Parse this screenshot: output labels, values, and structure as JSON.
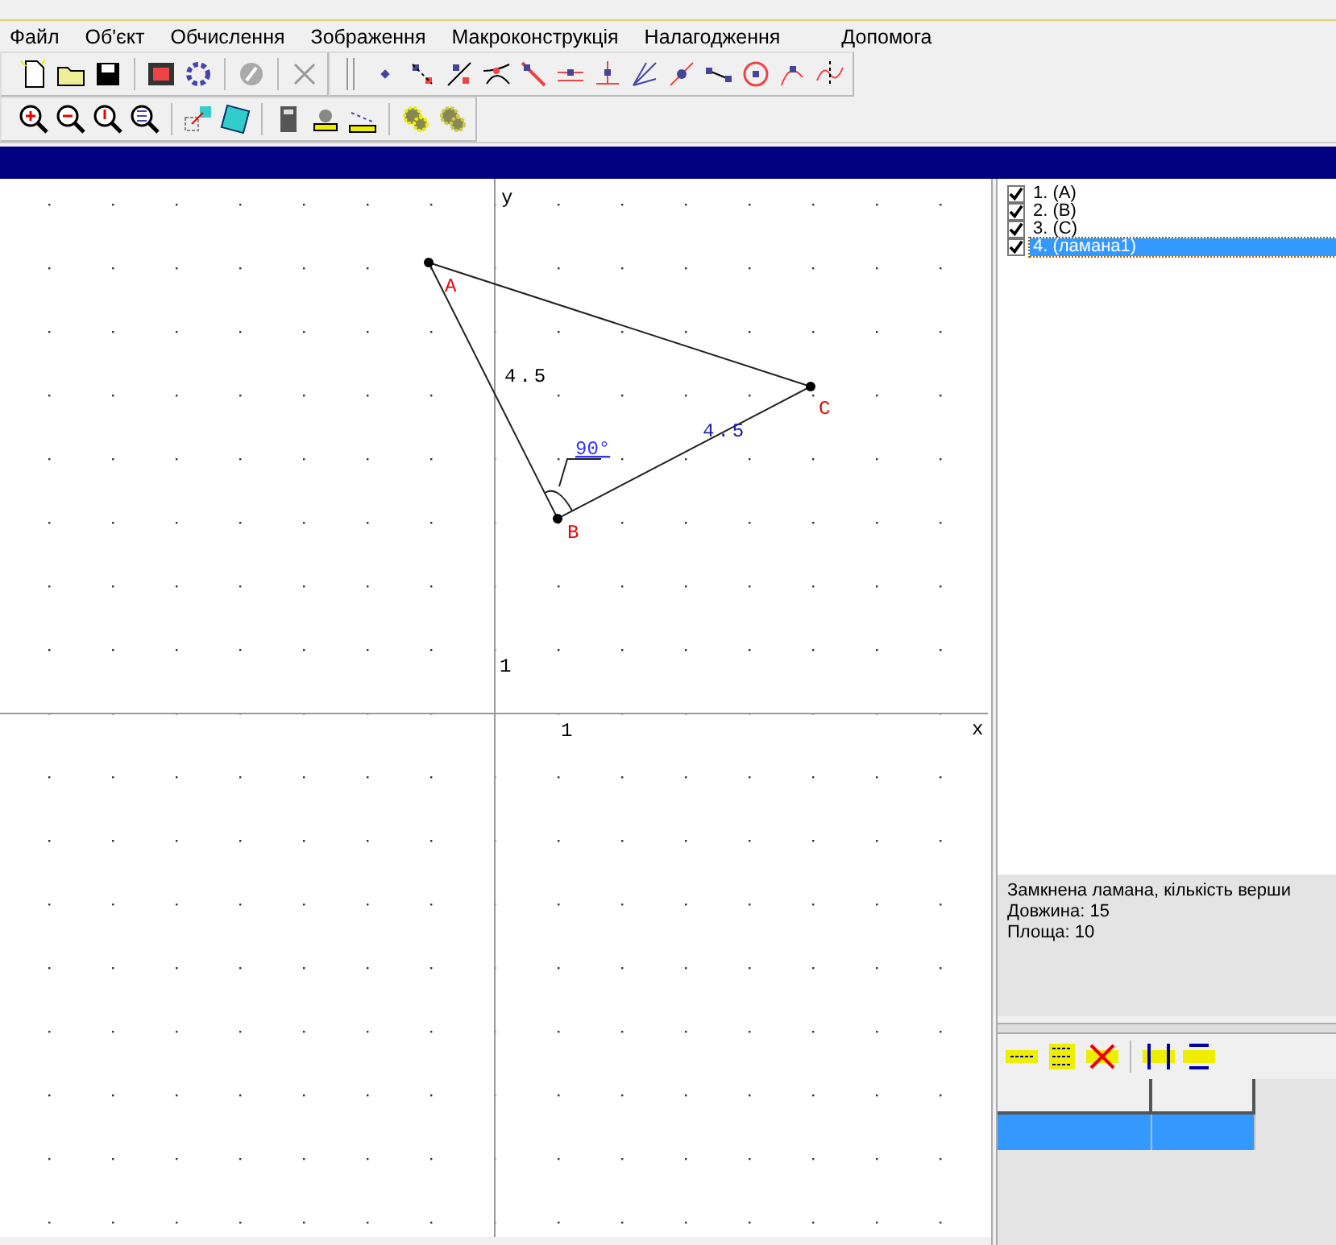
{
  "menu": [
    "Файл",
    "Об'єкт",
    "Обчислення",
    "Зображення",
    "Макроконструкція",
    "Налагодження",
    "Допомога"
  ],
  "canvas": {
    "x_axis_label": "x",
    "y_axis_label": "y",
    "x_tick": "1",
    "y_tick": "1",
    "points": [
      {
        "label": "A"
      },
      {
        "label": "B"
      },
      {
        "label": "C"
      }
    ],
    "side_lengths": [
      {
        "text": "4.5"
      },
      {
        "text": "4.5"
      }
    ],
    "angle": "90°"
  },
  "objects": [
    {
      "label": "1.  (A)",
      "checked": true,
      "selected": false
    },
    {
      "label": "2.  (B)",
      "checked": true,
      "selected": false
    },
    {
      "label": "3.  (C)",
      "checked": true,
      "selected": false
    },
    {
      "label": "4.  (ламана1)",
      "checked": true,
      "selected": true
    }
  ],
  "info": [
    "Замкнена ламана, кількість верши",
    "Довжина: 15",
    "Площа: 10"
  ],
  "table": {
    "rows": [
      {
        "selected": true
      }
    ]
  }
}
